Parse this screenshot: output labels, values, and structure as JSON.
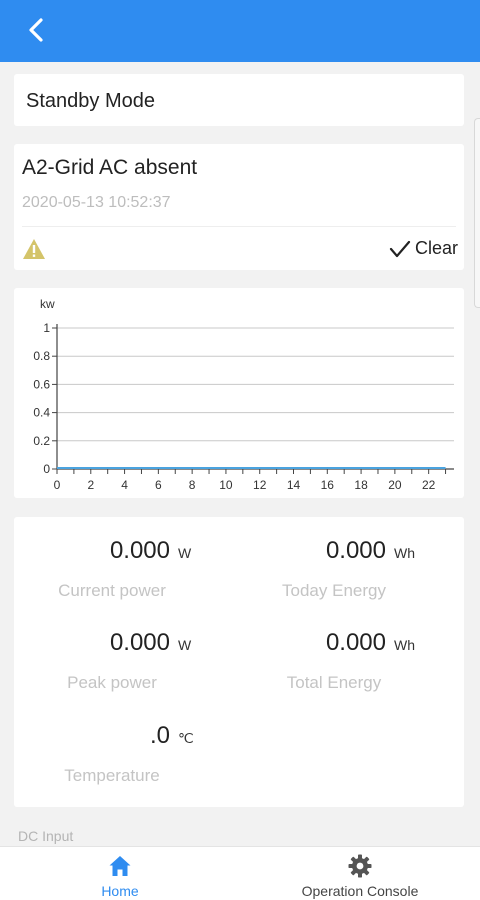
{
  "status": {
    "mode": "Standby Mode"
  },
  "alarm": {
    "title": "A2-Grid AC absent",
    "time": "2020-05-13 10:52:37",
    "clear_label": "Clear",
    "icon": "warning-icon",
    "icon_color": "#d4c46a"
  },
  "chart_data": {
    "type": "line",
    "ylabel": "kw",
    "xlabel": "",
    "x": [
      0,
      1,
      2,
      3,
      4,
      5,
      6,
      7,
      8,
      9,
      10,
      11,
      12,
      13,
      14,
      15,
      16,
      17,
      18,
      19,
      20,
      21,
      22,
      23
    ],
    "series": [
      {
        "values": [
          0,
          0,
          0,
          0,
          0,
          0,
          0,
          0,
          0,
          0,
          0,
          0,
          0,
          0,
          0,
          0,
          0,
          0,
          0,
          0,
          0,
          0,
          0,
          0
        ],
        "color": "#4aa3df"
      }
    ],
    "xticks": [
      "0",
      "2",
      "4",
      "6",
      "8",
      "10",
      "12",
      "14",
      "16",
      "18",
      "20",
      "22"
    ],
    "yticks": [
      "0",
      "0.2",
      "0.4",
      "0.6",
      "0.8",
      "1"
    ],
    "xlim": [
      0,
      23.5
    ],
    "ylim": [
      0,
      1
    ],
    "grid": true
  },
  "stats": {
    "current_power": {
      "value": "0.000",
      "unit": "W",
      "label": "Current power"
    },
    "today_energy": {
      "value": "0.000",
      "unit": "Wh",
      "label": "Today Energy"
    },
    "peak_power": {
      "value": "0.000",
      "unit": "W",
      "label": "Peak power"
    },
    "total_energy": {
      "value": "0.000",
      "unit": "Wh",
      "label": "Total Energy"
    },
    "temperature": {
      "value": ".0",
      "unit": "℃",
      "label": "Temperature"
    }
  },
  "section": {
    "dc_input": "DC Input"
  },
  "nav": {
    "home": "Home",
    "console": "Operation Console",
    "active_color": "#2f8cf0"
  },
  "colors": {
    "header": "#2f8cf0",
    "background": "#f2f2f2"
  }
}
